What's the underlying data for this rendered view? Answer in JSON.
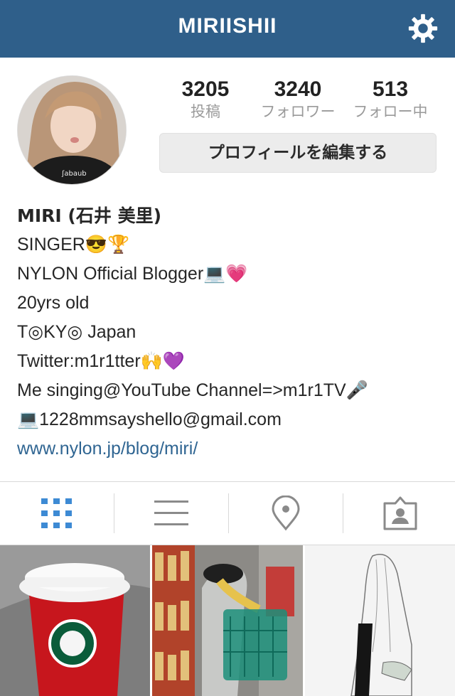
{
  "header": {
    "username": "MIRIISHII",
    "settings_icon": "gear-icon"
  },
  "stats": [
    {
      "value": "3205",
      "label": "投稿"
    },
    {
      "value": "3240",
      "label": "フォロワー"
    },
    {
      "value": "513",
      "label": "フォロー中"
    }
  ],
  "edit_profile_label": "プロフィールを編集する",
  "bio": {
    "name": "MIRI (石井 美里)",
    "lines": [
      "SINGER😎🏆",
      "NYLON Official Blogger💻💗",
      "20yrs old",
      "T◎KY◎ Japan",
      "Twitter:m1r1tter🙌💜",
      "Me singing@YouTube Channel=>m1r1TV🎤",
      "💻1228mmsayshello@gmail.com"
    ],
    "link": "www.nylon.jp/blog/miri/"
  },
  "tabs": [
    "grid-view-icon",
    "list-view-icon",
    "map-pin-icon",
    "tagged-photos-icon"
  ],
  "colors": {
    "header_bg": "#2f5f8a",
    "active_tab": "#3d8ad4",
    "inactive_tab": "#8a8a8a",
    "link": "#2f6592"
  }
}
